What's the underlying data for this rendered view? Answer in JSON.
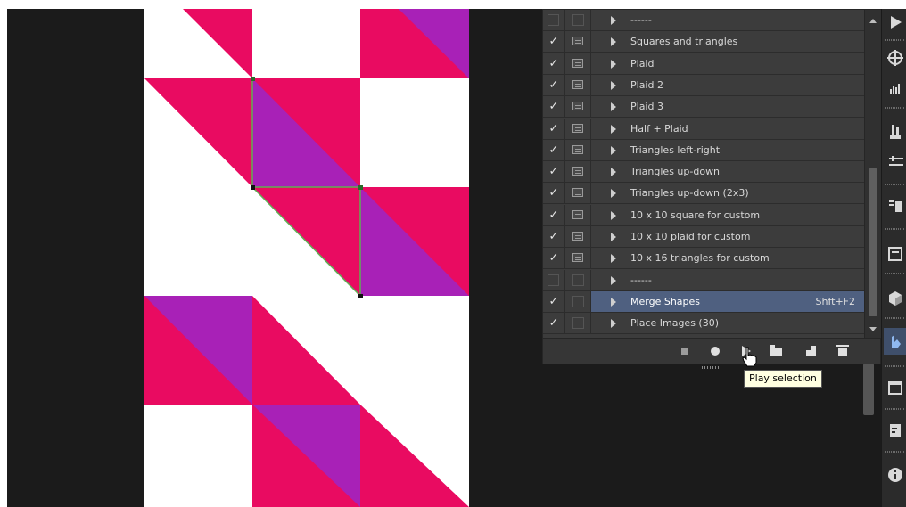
{
  "actions": [
    {
      "checked": false,
      "dialog": false,
      "label": "------",
      "selected": false,
      "shortcut": ""
    },
    {
      "checked": true,
      "dialog": true,
      "label": "Squares and triangles",
      "selected": false,
      "shortcut": ""
    },
    {
      "checked": true,
      "dialog": true,
      "label": "Plaid",
      "selected": false,
      "shortcut": ""
    },
    {
      "checked": true,
      "dialog": true,
      "label": "Plaid 2",
      "selected": false,
      "shortcut": ""
    },
    {
      "checked": true,
      "dialog": true,
      "label": "Plaid 3",
      "selected": false,
      "shortcut": ""
    },
    {
      "checked": true,
      "dialog": true,
      "label": "Half + Plaid",
      "selected": false,
      "shortcut": ""
    },
    {
      "checked": true,
      "dialog": true,
      "label": "Triangles left-right",
      "selected": false,
      "shortcut": ""
    },
    {
      "checked": true,
      "dialog": true,
      "label": "Triangles up-down",
      "selected": false,
      "shortcut": ""
    },
    {
      "checked": true,
      "dialog": true,
      "label": "Triangles up-down (2x3)",
      "selected": false,
      "shortcut": ""
    },
    {
      "checked": true,
      "dialog": true,
      "label": "10 x 10 square for custom",
      "selected": false,
      "shortcut": ""
    },
    {
      "checked": true,
      "dialog": true,
      "label": "10 x 10 plaid for custom",
      "selected": false,
      "shortcut": ""
    },
    {
      "checked": true,
      "dialog": true,
      "label": "10 x 16 triangles for custom",
      "selected": false,
      "shortcut": ""
    },
    {
      "checked": false,
      "dialog": false,
      "label": "------",
      "selected": false,
      "shortcut": ""
    },
    {
      "checked": true,
      "dialog": false,
      "label": "Merge Shapes",
      "selected": true,
      "shortcut": "Shft+F2"
    },
    {
      "checked": true,
      "dialog": false,
      "label": "Place Images (30)",
      "selected": false,
      "shortcut": ""
    }
  ],
  "check_glyph": "✓",
  "footer_icons": [
    "stop-icon",
    "record-icon",
    "play-icon",
    "folder-icon",
    "new-action-icon",
    "trash-icon"
  ],
  "tooltip": {
    "text": "Play selection"
  },
  "colors": {
    "magenta": "#e90b61",
    "purple": "#a821b7",
    "canvas_bg": "#ffffff",
    "workspace_bg": "#1b1b1b",
    "panel_bg": "#3c3c3c",
    "selection": "#4f6080",
    "path_outline": "#5fae55"
  },
  "dock_icons": [
    "play-icon",
    "navigator-icon",
    "histogram-icon",
    "brush-icon",
    "adjustments-icon",
    "layer-comps-icon",
    "properties-icon",
    "3d-icon",
    "actions-icon",
    "layers-icon",
    "notes-icon",
    "info-icon"
  ]
}
